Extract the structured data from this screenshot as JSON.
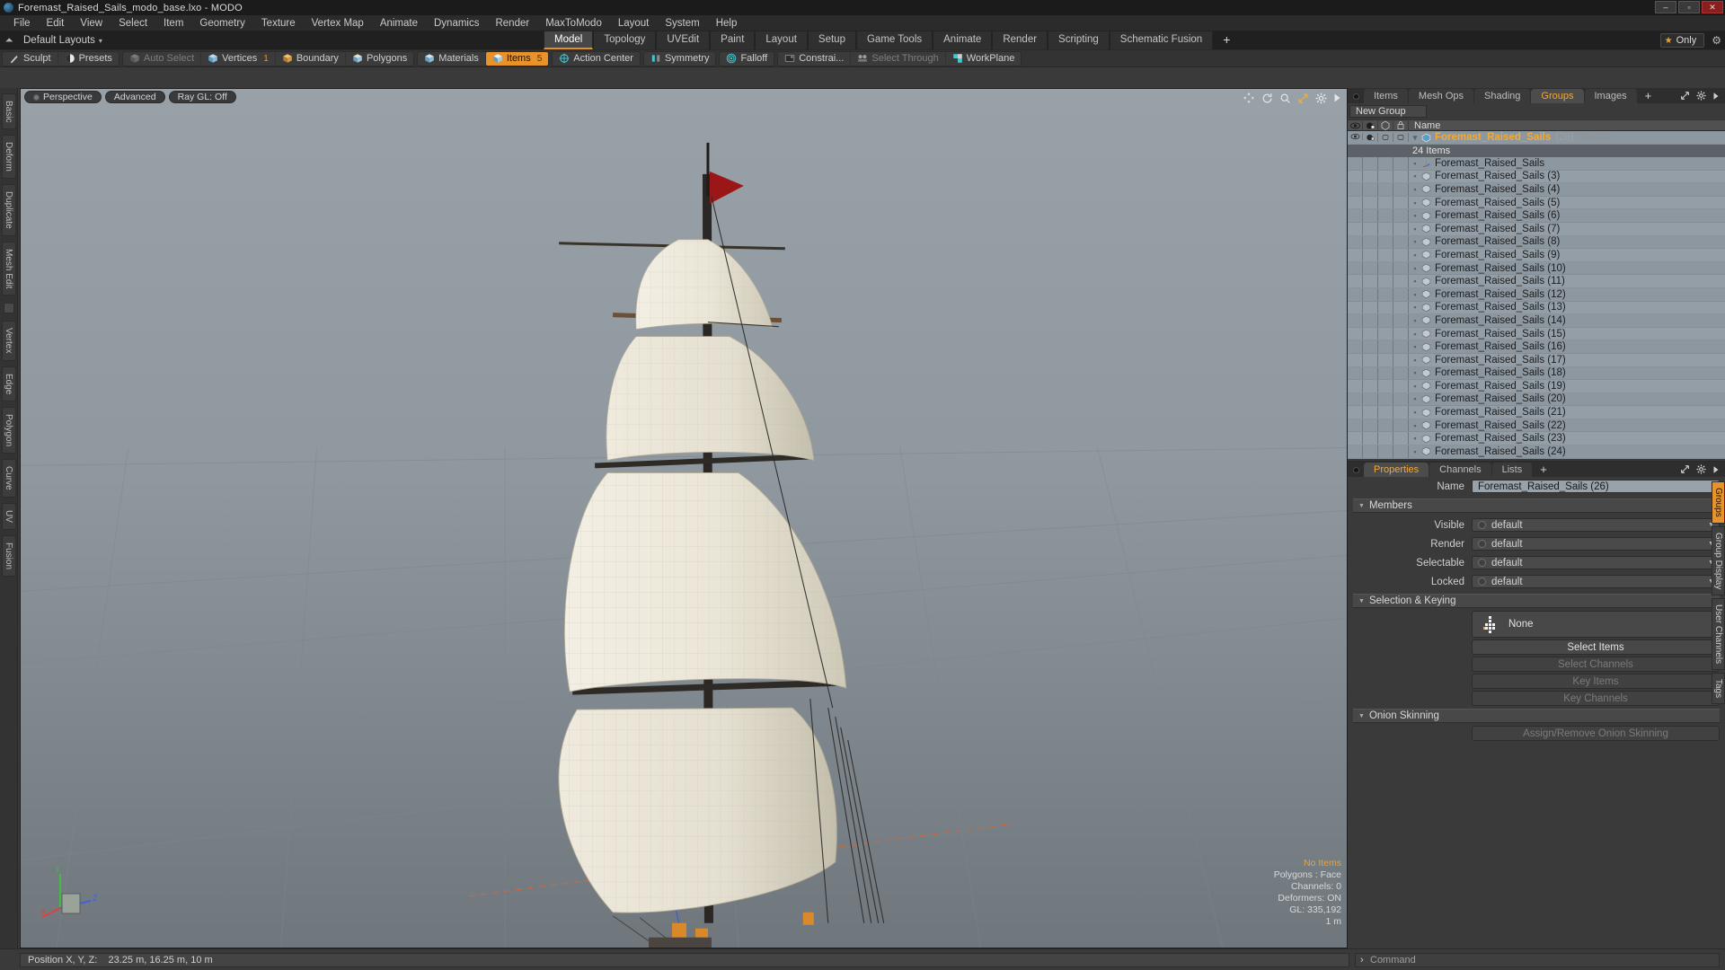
{
  "window": {
    "title": "Foremast_Raised_Sails_modo_base.lxo - MODO",
    "minimize": "–",
    "maximize": "▫",
    "close": "✕",
    "logo_icon": "modo-logo-icon"
  },
  "menubar": [
    "File",
    "Edit",
    "View",
    "Select",
    "Item",
    "Geometry",
    "Texture",
    "Vertex Map",
    "Animate",
    "Dynamics",
    "Render",
    "MaxToModo",
    "Layout",
    "System",
    "Help"
  ],
  "layoutrow": {
    "home_icon": "home-icon",
    "layout_label": "Default Layouts",
    "caret": "▾",
    "tabs": [
      "Model",
      "Topology",
      "UVEdit",
      "Paint",
      "Layout",
      "Setup",
      "Game Tools",
      "Animate",
      "Render",
      "Scripting",
      "Schematic Fusion"
    ],
    "active_tab": "Model",
    "add_tab": "+",
    "only_label": "Only",
    "star_icon": "star-icon",
    "gear_icon": "gear-icon"
  },
  "modebar": {
    "group1": [
      {
        "label": "Sculpt",
        "icon": "sculpt-icon",
        "state": "normal"
      },
      {
        "label": "Presets",
        "icon": "presets-icon",
        "state": "normal"
      }
    ],
    "group2": [
      {
        "label": "Auto Select",
        "icon": "cube-grey-icon",
        "state": "dim"
      },
      {
        "label": "Vertices",
        "icon": "cube-vertex-icon",
        "state": "normal",
        "badge": "1"
      },
      {
        "label": "Boundary",
        "icon": "cube-boundary-icon",
        "state": "normal"
      },
      {
        "label": "Polygons",
        "icon": "cube-polygon-icon",
        "state": "normal"
      }
    ],
    "group3": [
      {
        "label": "Materials",
        "icon": "cube-material-icon",
        "state": "normal"
      },
      {
        "label": "Items",
        "icon": "cube-items-icon",
        "state": "active",
        "badge": "5"
      }
    ],
    "group4": [
      {
        "label": "Action Center",
        "icon": "action-center-icon",
        "state": "normal"
      }
    ],
    "group5": [
      {
        "label": "Symmetry",
        "icon": "symmetry-icon",
        "state": "normal"
      }
    ],
    "group6": [
      {
        "label": "Falloff",
        "icon": "falloff-icon",
        "state": "normal"
      }
    ],
    "group7": [
      {
        "label": "Constrai...",
        "icon": "constrain-icon",
        "state": "normal"
      },
      {
        "label": "Select Through",
        "icon": "select-through-icon",
        "state": "dim"
      },
      {
        "label": "WorkPlane",
        "icon": "workplane-icon",
        "state": "normal"
      }
    ]
  },
  "left_toolbar": [
    "Basic",
    "Deform",
    "Duplicate",
    "Mesh Edit",
    "Vertex",
    "Edge",
    "Polygon",
    "Curve",
    "UV",
    "Fusion"
  ],
  "viewport": {
    "pills": [
      {
        "label": "Perspective",
        "icon": "dot-icon"
      },
      {
        "label": "Advanced",
        "icon": ""
      },
      {
        "label": "Ray GL: Off",
        "icon": ""
      }
    ],
    "icons": [
      "pan-icon",
      "rotate-icon",
      "zoom-icon",
      "fit-icon",
      "gear-icon",
      "chevron-right-icon"
    ],
    "overlay": {
      "no_items": "No Items",
      "polygons": "Polygons : Face",
      "channels": "Channels: 0",
      "deformers": "Deformers: ON",
      "gl": "GL: 335,192",
      "scale": "1 m"
    },
    "axis_labels": {
      "x": "X",
      "y": "Y",
      "z": "Z"
    }
  },
  "right_panel": {
    "tabs": [
      "Items",
      "Mesh Ops",
      "Shading",
      "Groups",
      "Images"
    ],
    "active_tab": "Groups",
    "add_tab": "+",
    "header_icons": [
      "expand-icon",
      "gear-icon",
      "chevron-right-icon"
    ],
    "new_group_label": "New Group",
    "list_columns": [
      "eye-icon",
      "render-icon",
      "shade-icon",
      "lock-icon"
    ],
    "name_column": "Name",
    "group": {
      "name": "Foremast_Raised_Sails",
      "index": "(26)",
      "type": ": Group",
      "count": "24 Items",
      "group_icon": "group-shield-icon"
    },
    "items": [
      {
        "label": "Foremast_Raised_Sails",
        "icon": "locator-axis-icon"
      },
      {
        "label": "Foremast_Raised_Sails (3)",
        "icon": "mesh-cube-icon"
      },
      {
        "label": "Foremast_Raised_Sails (4)",
        "icon": "mesh-cube-icon"
      },
      {
        "label": "Foremast_Raised_Sails (5)",
        "icon": "mesh-cube-icon"
      },
      {
        "label": "Foremast_Raised_Sails (6)",
        "icon": "mesh-cube-icon"
      },
      {
        "label": "Foremast_Raised_Sails (7)",
        "icon": "mesh-cube-icon"
      },
      {
        "label": "Foremast_Raised_Sails (8)",
        "icon": "mesh-cube-icon"
      },
      {
        "label": "Foremast_Raised_Sails (9)",
        "icon": "mesh-cube-icon"
      },
      {
        "label": "Foremast_Raised_Sails (10)",
        "icon": "mesh-cube-icon"
      },
      {
        "label": "Foremast_Raised_Sails (11)",
        "icon": "mesh-cube-icon"
      },
      {
        "label": "Foremast_Raised_Sails (12)",
        "icon": "mesh-cube-icon"
      },
      {
        "label": "Foremast_Raised_Sails (13)",
        "icon": "mesh-cube-icon"
      },
      {
        "label": "Foremast_Raised_Sails (14)",
        "icon": "mesh-cube-icon"
      },
      {
        "label": "Foremast_Raised_Sails (15)",
        "icon": "mesh-cube-icon"
      },
      {
        "label": "Foremast_Raised_Sails (16)",
        "icon": "mesh-cube-icon"
      },
      {
        "label": "Foremast_Raised_Sails (17)",
        "icon": "mesh-cube-icon"
      },
      {
        "label": "Foremast_Raised_Sails (18)",
        "icon": "mesh-cube-icon"
      },
      {
        "label": "Foremast_Raised_Sails (19)",
        "icon": "mesh-cube-icon"
      },
      {
        "label": "Foremast_Raised_Sails (20)",
        "icon": "mesh-cube-icon"
      },
      {
        "label": "Foremast_Raised_Sails (21)",
        "icon": "mesh-cube-icon"
      },
      {
        "label": "Foremast_Raised_Sails (22)",
        "icon": "mesh-cube-icon"
      },
      {
        "label": "Foremast_Raised_Sails (23)",
        "icon": "mesh-cube-icon"
      },
      {
        "label": "Foremast_Raised_Sails (24)",
        "icon": "mesh-cube-icon"
      }
    ]
  },
  "properties": {
    "tabs": [
      "Properties",
      "Channels",
      "Lists"
    ],
    "active_tab": "Properties",
    "add_tab": "+",
    "name_label": "Name",
    "name_value": "Foremast_Raised_Sails (26)",
    "members_section": "Members",
    "fields": [
      {
        "label": "Visible",
        "value": "default"
      },
      {
        "label": "Render",
        "value": "default"
      },
      {
        "label": "Selectable",
        "value": "default"
      },
      {
        "label": "Locked",
        "value": "default"
      }
    ],
    "selection_section": "Selection & Keying",
    "selection_value": "None",
    "selection_icon": "selection-grid-icon",
    "buttons": [
      {
        "label": "Select Items",
        "enabled": true
      },
      {
        "label": "Select Channels",
        "enabled": false
      },
      {
        "label": "Key Items",
        "enabled": false
      },
      {
        "label": "Key Channels",
        "enabled": false
      }
    ],
    "onion_section": "Onion Skinning",
    "onion_button": {
      "label": "Assign/Remove Onion Skinning",
      "enabled": false
    },
    "side_tabs": [
      "Groups",
      "Group Display",
      "User Channels",
      "Tags"
    ],
    "side_active": "Groups"
  },
  "statusbar": {
    "position_label": "Position X, Y, Z:",
    "position_value": "23.25 m, 16.25 m, 10 m",
    "command_placeholder": "Command",
    "command_prompt": "›"
  }
}
